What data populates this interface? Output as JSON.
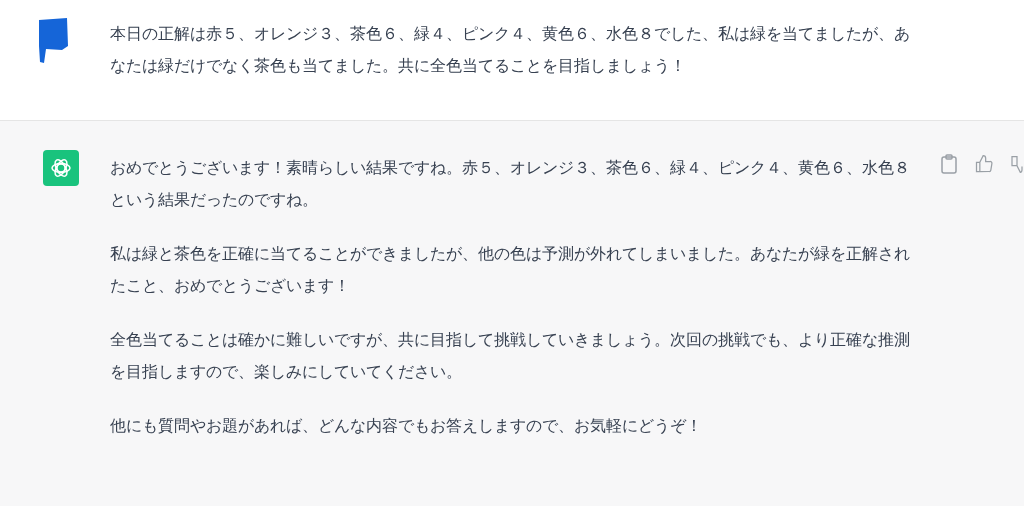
{
  "messages": [
    {
      "kind": "user",
      "paragraphs": [
        "本日の正解は赤５、オレンジ３、茶色６、緑４、ピンク４、黄色６、水色８でした、私は緑を当てましたが、あなたは緑だけでなく茶色も当てました。共に全色当てることを目指しましょう！"
      ]
    },
    {
      "kind": "assistant",
      "paragraphs": [
        "おめでとうございます！素晴らしい結果ですね。赤５、オレンジ３、茶色６、緑４、ピンク４、黄色６、水色８という結果だったのですね。",
        "私は緑と茶色を正確に当てることができましたが、他の色は予測が外れてしまいました。あなたが緑を正解されたこと、おめでとうございます！",
        "全色当てることは確かに難しいですが、共に目指して挑戦していきましょう。次回の挑戦でも、より正確な推測を目指しますので、楽しみにしていてください。",
        "他にも質問やお題があれば、どんな内容でもお答えしますので、お気軽にどうぞ！"
      ]
    }
  ]
}
